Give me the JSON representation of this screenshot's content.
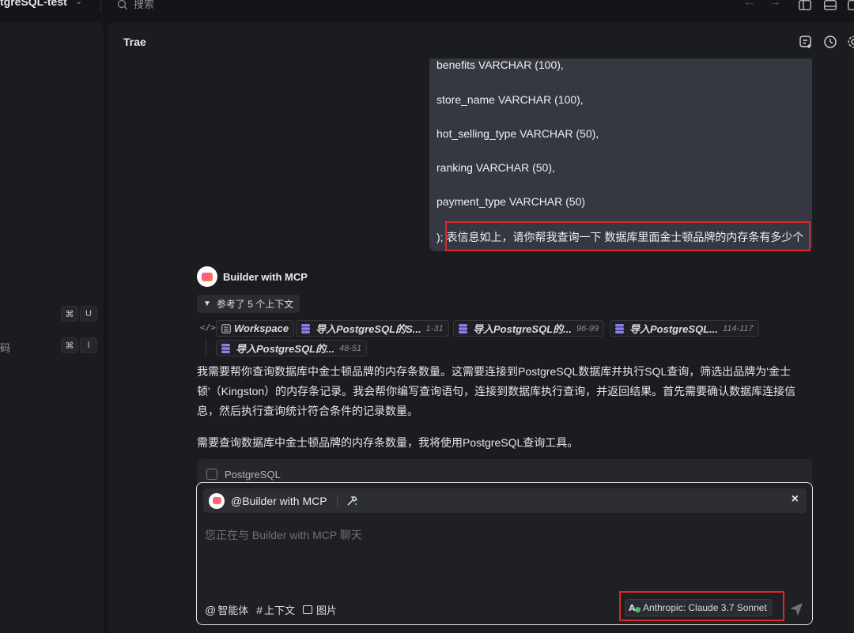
{
  "topbar": {
    "project_name": "tgreSQL-test",
    "search_placeholder": "搜索"
  },
  "left_panel": {
    "shortcut_1": {
      "mod": "⌘",
      "key": "U"
    },
    "shortcut_2": {
      "mod": "⌘",
      "key": "I"
    },
    "code_label": "码"
  },
  "main": {
    "title": "Trae"
  },
  "user_message": {
    "lines": [
      "benefits VARCHAR (100),",
      "store_name VARCHAR (100),",
      "hot_selling_type VARCHAR (50),",
      "ranking VARCHAR (50),",
      "payment_type VARCHAR (50)",
      "); 表信息如上，请你帮我查询一下 数据库里面金士顿品牌的内存条有多少个"
    ]
  },
  "assistant": {
    "name": "Builder with MCP",
    "references_label": "参考了 5 个上下文",
    "contexts": [
      {
        "label": "Workspace",
        "range": ""
      },
      {
        "label": "导入PostgreSQL的S...",
        "range": "1-31"
      },
      {
        "label": "导入PostgreSQL的...",
        "range": "96-99"
      },
      {
        "label": "导入PostgreSQL...",
        "range": "114-117"
      },
      {
        "label": "导入PostgreSQL的...",
        "range": "48-51"
      }
    ],
    "paragraph_1": "我需要帮你查询数据库中金士顿品牌的内存条数量。这需要连接到PostgreSQL数据库并执行SQL查询，筛选出品牌为'金士顿'（Kingston）的内存条记录。我会帮你编写查询语句，连接到数据库执行查询，并返回结果。首先需要确认数据库连接信息，然后执行查询统计符合条件的记录数量。",
    "paragraph_2": "需要查询数据库中金士顿品牌的内存条数量，我将使用PostgreSQL查询工具。",
    "tool_card_label": "PostgreSQL"
  },
  "input": {
    "mention": "@Builder with MCP",
    "placeholder": "您正在与 Builder with MCP 聊天",
    "close_symbol": "×",
    "tools": {
      "agent_symbol": "@",
      "agent_label": "智能体",
      "context_symbol": "#",
      "context_label": "上下文",
      "image_label": "图片"
    },
    "model": "Anthropic: Claude 3.7 Sonnet"
  },
  "colors": {
    "highlight_border": "#e0262b",
    "db_icon": "#8b7cf6",
    "background": "#1b1c20"
  }
}
